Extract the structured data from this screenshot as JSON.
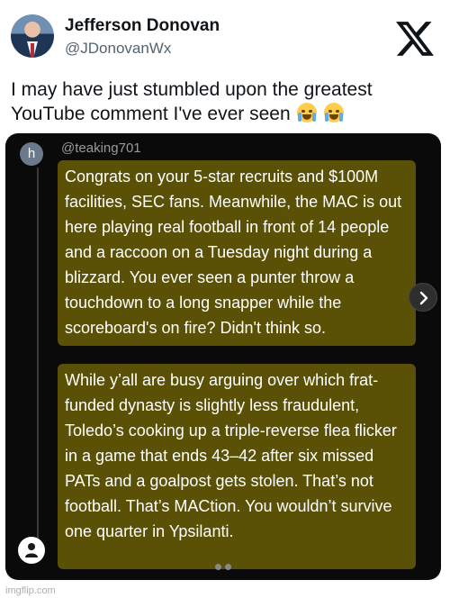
{
  "tweet": {
    "author_name": "Jefferson Donovan",
    "author_handle": "@JDonovanWx",
    "text": "I may have just stumbled upon the greatest YouTube comment I've ever seen",
    "emojis": [
      "loudly-crying-face",
      "face-with-tears-of-joy"
    ]
  },
  "embedded": {
    "avatar_letter": "h",
    "username": "@teaking701",
    "paragraph_1": "Congrats on your 5-star recruits and $100M facilities, SEC fans. Meanwhile, the MAC is out here playing real football in front of 14 people and a raccoon on a Tuesday night during a blizzard. You ever seen a punter throw a touchdown to a long snapper while the scoreboard's on fire? Didn't think so.",
    "paragraph_2": "While y’all are busy arguing over which frat-funded dynasty is slightly less fraudulent, Toledo’s cooking up a triple-reverse flea flicker in a game that ends 43–42 after six missed PATs and a goalpost gets stolen. That’s not football. That’s MACtion. You wouldn’t survive one quarter in Ypsilanti.",
    "highlight_color": "#5a5107"
  },
  "watermark": "imgflip.com"
}
